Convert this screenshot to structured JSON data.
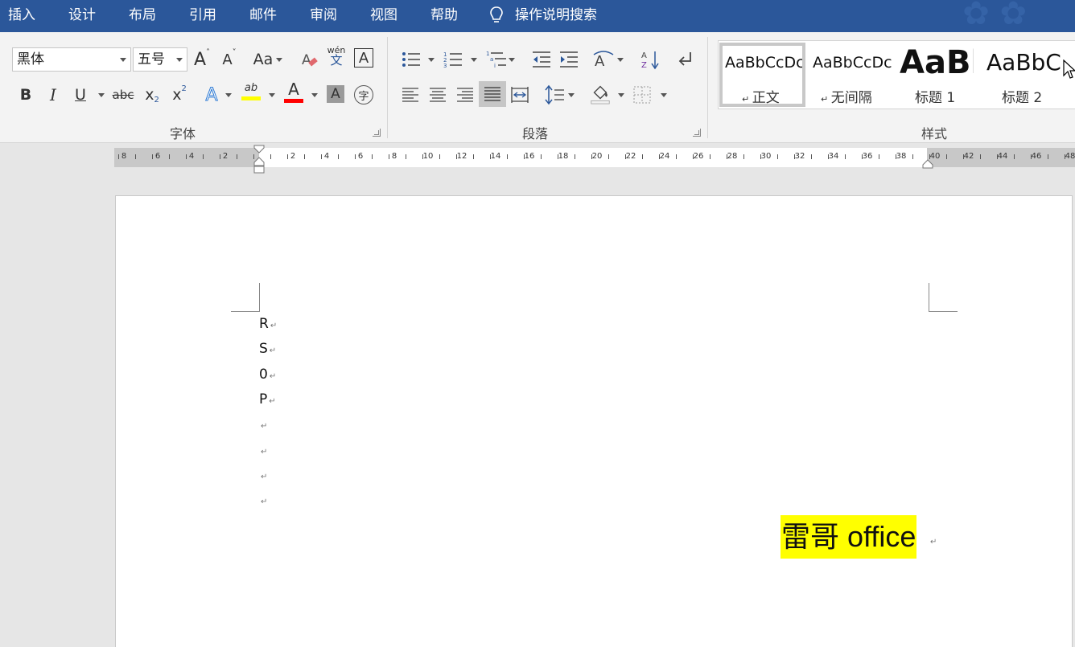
{
  "menu": {
    "items": [
      "插入",
      "设计",
      "布局",
      "引用",
      "邮件",
      "审阅",
      "视图",
      "帮助"
    ],
    "search_label": "操作说明搜索"
  },
  "font_group": {
    "font_name": "黑体",
    "font_size": "五号",
    "grow_label": "A",
    "shrink_label": "A",
    "change_case_label": "Aa",
    "phonetic_top": "wén",
    "phonetic_bottom": "文",
    "border_char": "A",
    "bold": "B",
    "italic": "I",
    "underline": "U",
    "strike": "abc",
    "subscript": "x",
    "sub_mark": "2",
    "superscript": "x",
    "sup_mark": "2",
    "text_effect": "A",
    "highlight_label": "ab",
    "font_color": "A",
    "char_shading": "A",
    "enclose_char": "字",
    "label": "字体"
  },
  "paragraph_group": {
    "label": "段落"
  },
  "styles_group": {
    "label": "样式",
    "items": [
      {
        "preview": "AaBbCcDc",
        "name": "正文",
        "selected": true
      },
      {
        "preview": "AaBbCcDc",
        "name": "无间隔",
        "selected": false
      },
      {
        "preview": "AaBb",
        "name": "标题 1",
        "selected": false
      },
      {
        "preview": "AaBbC",
        "name": "标题 2",
        "selected": false
      }
    ]
  },
  "ruler": {
    "left_numbers": [
      "8",
      "6",
      "4",
      "2"
    ],
    "right_numbers": [
      "2",
      "4",
      "6",
      "8",
      "10",
      "12",
      "14",
      "16",
      "18",
      "20",
      "22",
      "24",
      "26",
      "28",
      "30",
      "32",
      "34",
      "36",
      "38",
      "40",
      "42",
      "44",
      "46",
      "48"
    ]
  },
  "document": {
    "lines": [
      "R",
      "S",
      "0",
      "P",
      "",
      "",
      "",
      ""
    ],
    "paragraph_mark": "↵",
    "highlighted_text": "雷哥 office",
    "highlight_color": "#ffff00"
  },
  "colors": {
    "title_bar": "#2b579a",
    "highlight_bar": "#ffff00",
    "font_color_bar": "#ff0000"
  }
}
